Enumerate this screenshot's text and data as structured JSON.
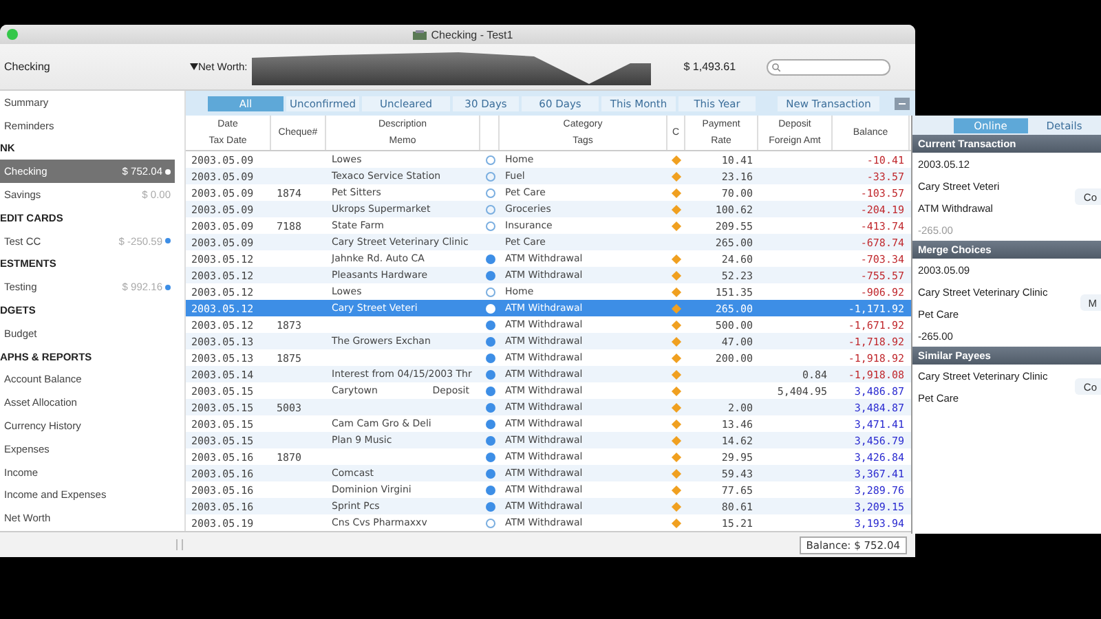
{
  "window": {
    "title": "Checking - Test1"
  },
  "toolbar": {
    "account": "Checking",
    "net_worth_label": "Net Worth:",
    "net_worth_value": "$ 1,493.61"
  },
  "sidebar": {
    "items": [
      {
        "kind": "item",
        "label": "Summary",
        "selected": false
      },
      {
        "kind": "item",
        "label": "Reminders",
        "selected": false
      },
      {
        "kind": "section",
        "label": "NK"
      },
      {
        "kind": "item",
        "label": "Checking",
        "amount": "$ 752.04",
        "dot": true,
        "selected": true
      },
      {
        "kind": "item",
        "label": "Savings",
        "amount": "$ 0.00",
        "dot": false,
        "selected": false
      },
      {
        "kind": "section",
        "label": "EDIT CARDS"
      },
      {
        "kind": "item",
        "label": "Test CC",
        "amount": "$ -250.59",
        "dot": true,
        "selected": false
      },
      {
        "kind": "section",
        "label": "ESTMENTS"
      },
      {
        "kind": "item",
        "label": "Testing",
        "amount": "$ 992.16",
        "dot": true,
        "selected": false
      },
      {
        "kind": "section",
        "label": "DGETS"
      },
      {
        "kind": "item",
        "label": "Budget",
        "selected": false
      },
      {
        "kind": "section",
        "label": "APHS & REPORTS"
      },
      {
        "kind": "item",
        "label": "Account Balance",
        "selected": false
      },
      {
        "kind": "item",
        "label": "Asset Allocation",
        "selected": false
      },
      {
        "kind": "item",
        "label": "Currency History",
        "selected": false
      },
      {
        "kind": "item",
        "label": "Expenses",
        "selected": false
      },
      {
        "kind": "item",
        "label": "Income",
        "selected": false
      },
      {
        "kind": "item",
        "label": "Income and Expenses",
        "selected": false
      },
      {
        "kind": "item",
        "label": "Net Worth",
        "selected": false
      }
    ]
  },
  "filters": [
    {
      "label": "All",
      "selected": true
    },
    {
      "label": "Unconfirmed",
      "selected": false
    },
    {
      "label": "Uncleared",
      "selected": false
    },
    {
      "label": "30 Days",
      "selected": false
    },
    {
      "label": "60 Days",
      "selected": false
    },
    {
      "label": "This Month",
      "selected": false
    },
    {
      "label": "This Year",
      "selected": false
    }
  ],
  "new_transaction": "New Transaction",
  "table": {
    "columns": [
      {
        "top": "Date",
        "bottom": "Tax Date"
      },
      {
        "top": "Cheque#"
      },
      {
        "top": "Description",
        "bottom": "Memo"
      },
      {},
      {
        "top": "Category",
        "bottom": "Tags"
      },
      {
        "top": "C"
      },
      {
        "top": "Payment",
        "bottom": "Rate"
      },
      {
        "top": "Deposit",
        "bottom": "Foreign Amt"
      },
      {
        "top": "Balance"
      }
    ],
    "rows": [
      {
        "date": "2003.05.09",
        "description": "Lowes",
        "marked": true,
        "cleared": false,
        "category": "Home",
        "confirmed": true,
        "payment": "10.41",
        "balance": "-10.41",
        "negative": true,
        "selected": false
      },
      {
        "date": "2003.05.09",
        "description": "Texaco Service Station",
        "marked": true,
        "cleared": false,
        "category": "Fuel",
        "confirmed": true,
        "payment": "23.16",
        "balance": "-33.57",
        "negative": true,
        "selected": false
      },
      {
        "date": "2003.05.09",
        "cheque": "1874",
        "description": "Pet Sitters",
        "marked": true,
        "cleared": false,
        "category": "Pet Care",
        "confirmed": true,
        "payment": "70.00",
        "balance": "-103.57",
        "negative": true,
        "selected": false
      },
      {
        "date": "2003.05.09",
        "description": "Ukrops Supermarket",
        "marked": true,
        "cleared": false,
        "category": "Groceries",
        "confirmed": true,
        "payment": "100.62",
        "balance": "-204.19",
        "negative": true,
        "selected": false
      },
      {
        "date": "2003.05.09",
        "cheque": "7188",
        "description": "State Farm",
        "marked": true,
        "cleared": false,
        "category": "Insurance",
        "confirmed": true,
        "payment": "209.55",
        "balance": "-413.74",
        "negative": true,
        "selected": false
      },
      {
        "date": "2003.05.09",
        "description": "Cary Street Veterinary Clinic",
        "marked": false,
        "category": "Pet Care",
        "confirmed": false,
        "payment": "265.00",
        "balance": "-678.74",
        "negative": true,
        "selected": false
      },
      {
        "date": "2003.05.12",
        "description": "Jahnke Rd. Auto CA",
        "marked": true,
        "cleared": true,
        "category": "ATM Withdrawal",
        "confirmed": true,
        "payment": "24.60",
        "balance": "-703.34",
        "negative": true,
        "selected": false
      },
      {
        "date": "2003.05.12",
        "description": "Pleasants Hardware",
        "marked": true,
        "cleared": true,
        "category": "ATM Withdrawal",
        "confirmed": true,
        "payment": "52.23",
        "balance": "-755.57",
        "negative": true,
        "selected": false
      },
      {
        "date": "2003.05.12",
        "description": "Lowes",
        "marked": true,
        "cleared": false,
        "category": "Home",
        "confirmed": true,
        "payment": "151.35",
        "balance": "-906.92",
        "negative": true,
        "selected": false
      },
      {
        "date": "2003.05.12",
        "description": "Cary Street Veteri",
        "marked": true,
        "cleared": true,
        "category": "ATM Withdrawal",
        "confirmed": true,
        "payment": "265.00",
        "balance": "-1,171.92",
        "negative": true,
        "selected": true
      },
      {
        "date": "2003.05.12",
        "cheque": "1873",
        "marked": true,
        "cleared": true,
        "category": "ATM Withdrawal",
        "confirmed": true,
        "payment": "500.00",
        "balance": "-1,671.92",
        "negative": true,
        "selected": false
      },
      {
        "date": "2003.05.13",
        "description": "The Growers Exchan",
        "marked": true,
        "cleared": true,
        "category": "ATM Withdrawal",
        "confirmed": true,
        "payment": "47.00",
        "balance": "-1,718.92",
        "negative": true,
        "selected": false
      },
      {
        "date": "2003.05.13",
        "cheque": "1875",
        "marked": true,
        "cleared": true,
        "category": "ATM Withdrawal",
        "confirmed": true,
        "payment": "200.00",
        "balance": "-1,918.92",
        "negative": true,
        "selected": false
      },
      {
        "date": "2003.05.14",
        "description": "Interest from 04/15/2003 Thr",
        "marked": true,
        "cleared": true,
        "category": "ATM Withdrawal",
        "confirmed": true,
        "deposit": "0.84",
        "balance": "-1,918.08",
        "negative": true,
        "selected": false
      },
      {
        "date": "2003.05.15",
        "description": "Carytown",
        "memo": "Deposit",
        "marked": true,
        "cleared": true,
        "category": "ATM Withdrawal",
        "confirmed": true,
        "deposit": "5,404.95",
        "balance": "3,486.87",
        "negative": false,
        "selected": false
      },
      {
        "date": "2003.05.15",
        "cheque": "5003",
        "marked": true,
        "cleared": true,
        "category": "ATM Withdrawal",
        "confirmed": true,
        "payment": "2.00",
        "balance": "3,484.87",
        "negative": false,
        "selected": false
      },
      {
        "date": "2003.05.15",
        "description": "Cam Cam Gro & Deli",
        "marked": true,
        "cleared": true,
        "category": "ATM Withdrawal",
        "confirmed": true,
        "payment": "13.46",
        "balance": "3,471.41",
        "negative": false,
        "selected": false
      },
      {
        "date": "2003.05.15",
        "description": "Plan 9 Music",
        "marked": true,
        "cleared": true,
        "category": "ATM Withdrawal",
        "confirmed": true,
        "payment": "14.62",
        "balance": "3,456.79",
        "negative": false,
        "selected": false
      },
      {
        "date": "2003.05.16",
        "cheque": "1870",
        "marked": true,
        "cleared": true,
        "category": "ATM Withdrawal",
        "confirmed": true,
        "payment": "29.95",
        "balance": "3,426.84",
        "negative": false,
        "selected": false
      },
      {
        "date": "2003.05.16",
        "description": "Comcast",
        "marked": true,
        "cleared": true,
        "category": "ATM Withdrawal",
        "confirmed": true,
        "payment": "59.43",
        "balance": "3,367.41",
        "negative": false,
        "selected": false
      },
      {
        "date": "2003.05.16",
        "description": "Dominion Virgini",
        "marked": true,
        "cleared": true,
        "category": "ATM Withdrawal",
        "confirmed": true,
        "payment": "77.65",
        "balance": "3,289.76",
        "negative": false,
        "selected": false
      },
      {
        "date": "2003.05.16",
        "description": "Sprint Pcs",
        "marked": true,
        "cleared": true,
        "category": "ATM Withdrawal",
        "confirmed": true,
        "payment": "80.61",
        "balance": "3,209.15",
        "negative": false,
        "selected": false
      },
      {
        "date": "2003.05.19",
        "description": "Cns Cvs Pharmaxxv",
        "marked": true,
        "cleared": false,
        "category": "ATM Withdrawal",
        "confirmed": true,
        "payment": "15.21",
        "balance": "3,193.94",
        "negative": false,
        "selected": false
      }
    ]
  },
  "status_bar": {
    "balance": "Balance: $ 752.04"
  },
  "side_panel": {
    "tabs": [
      {
        "label": "Online",
        "selected": true
      },
      {
        "label": "Details",
        "selected": false
      }
    ],
    "sections": [
      {
        "title": "Current Transaction",
        "lines": [
          {
            "text": "2003.05.12",
            "muted": false
          },
          {
            "text": "Cary Street Veteri",
            "muted": false
          },
          {
            "text": "ATM Withdrawal",
            "muted": false
          },
          {
            "text": "-265.00",
            "muted": true
          }
        ],
        "button": "Co"
      },
      {
        "title": "Merge Choices",
        "lines": [
          {
            "text": "2003.05.09",
            "muted": false
          },
          {
            "text": "Cary Street Veterinary Clinic",
            "muted": false
          },
          {
            "text": "Pet Care",
            "muted": false
          },
          {
            "text": "-265.00",
            "muted": false
          }
        ],
        "button": "M"
      },
      {
        "title": "Similar Payees",
        "lines": [
          {
            "text": "Cary Street Veterinary Clinic",
            "muted": false
          },
          {
            "text": "Pet Care",
            "muted": false
          }
        ],
        "button": "Co"
      }
    ]
  }
}
